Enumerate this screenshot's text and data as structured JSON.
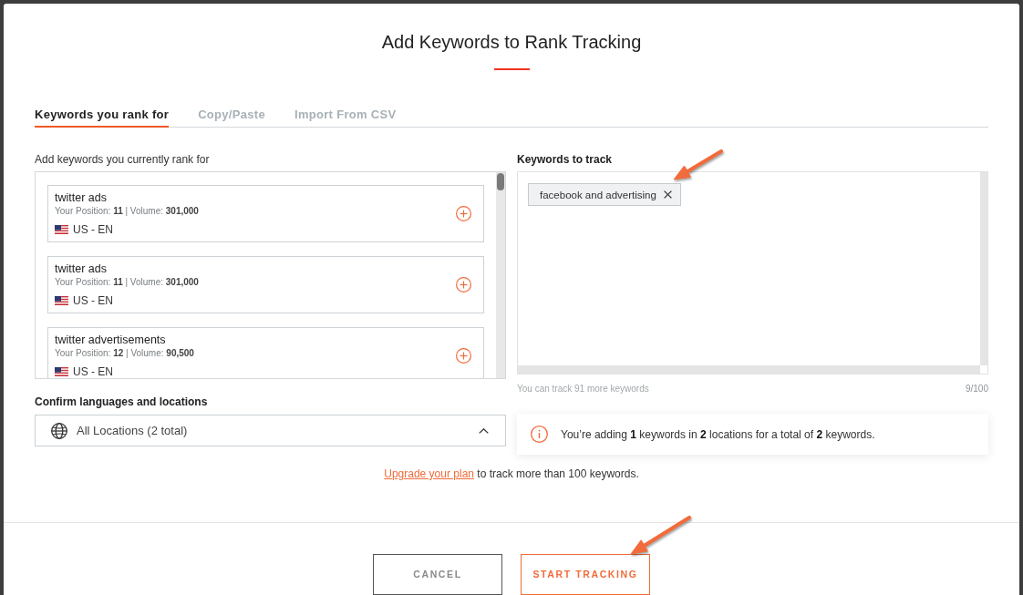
{
  "dialog": {
    "title": "Add Keywords to Rank Tracking"
  },
  "tabs": [
    {
      "label": "Keywords you rank for",
      "selected": true
    },
    {
      "label": "Copy/Paste",
      "selected": false
    },
    {
      "label": "Import From CSV",
      "selected": false
    }
  ],
  "ranked_keywords": {
    "label": "Add keywords you currently rank for",
    "items": [
      {
        "keyword": "twitter ads",
        "details": "Your Position: **11** | Volume: **301,000**",
        "locale": "US - EN"
      },
      {
        "keyword": "twitter ads",
        "details": "Your Position: **11** | Volume: **301,000**",
        "locale": "US - EN"
      },
      {
        "keyword": "twitter advertisements",
        "details": "Your Position: **12** | Volume: **90,500**",
        "locale": "US - EN"
      }
    ]
  },
  "keywords_to_track": {
    "label": "Keywords to track",
    "chips": [
      "facebook and advertising"
    ],
    "remaining": "You can track 91 more keywords",
    "count": "9/100"
  },
  "locations": {
    "label": "Confirm languages and locations",
    "value": "All Locations (2 total)"
  },
  "summary": "You’re adding **1** keywords in **2** locations for a total of **2** keywords.",
  "upgrade": {
    "link": "Upgrade your plan",
    "text": "to track more than 100 keywords."
  },
  "buttons": [
    {
      "label": "CANCEL",
      "kind": "secondary"
    },
    {
      "label": "START TRACKING",
      "kind": "primary"
    }
  ]
}
